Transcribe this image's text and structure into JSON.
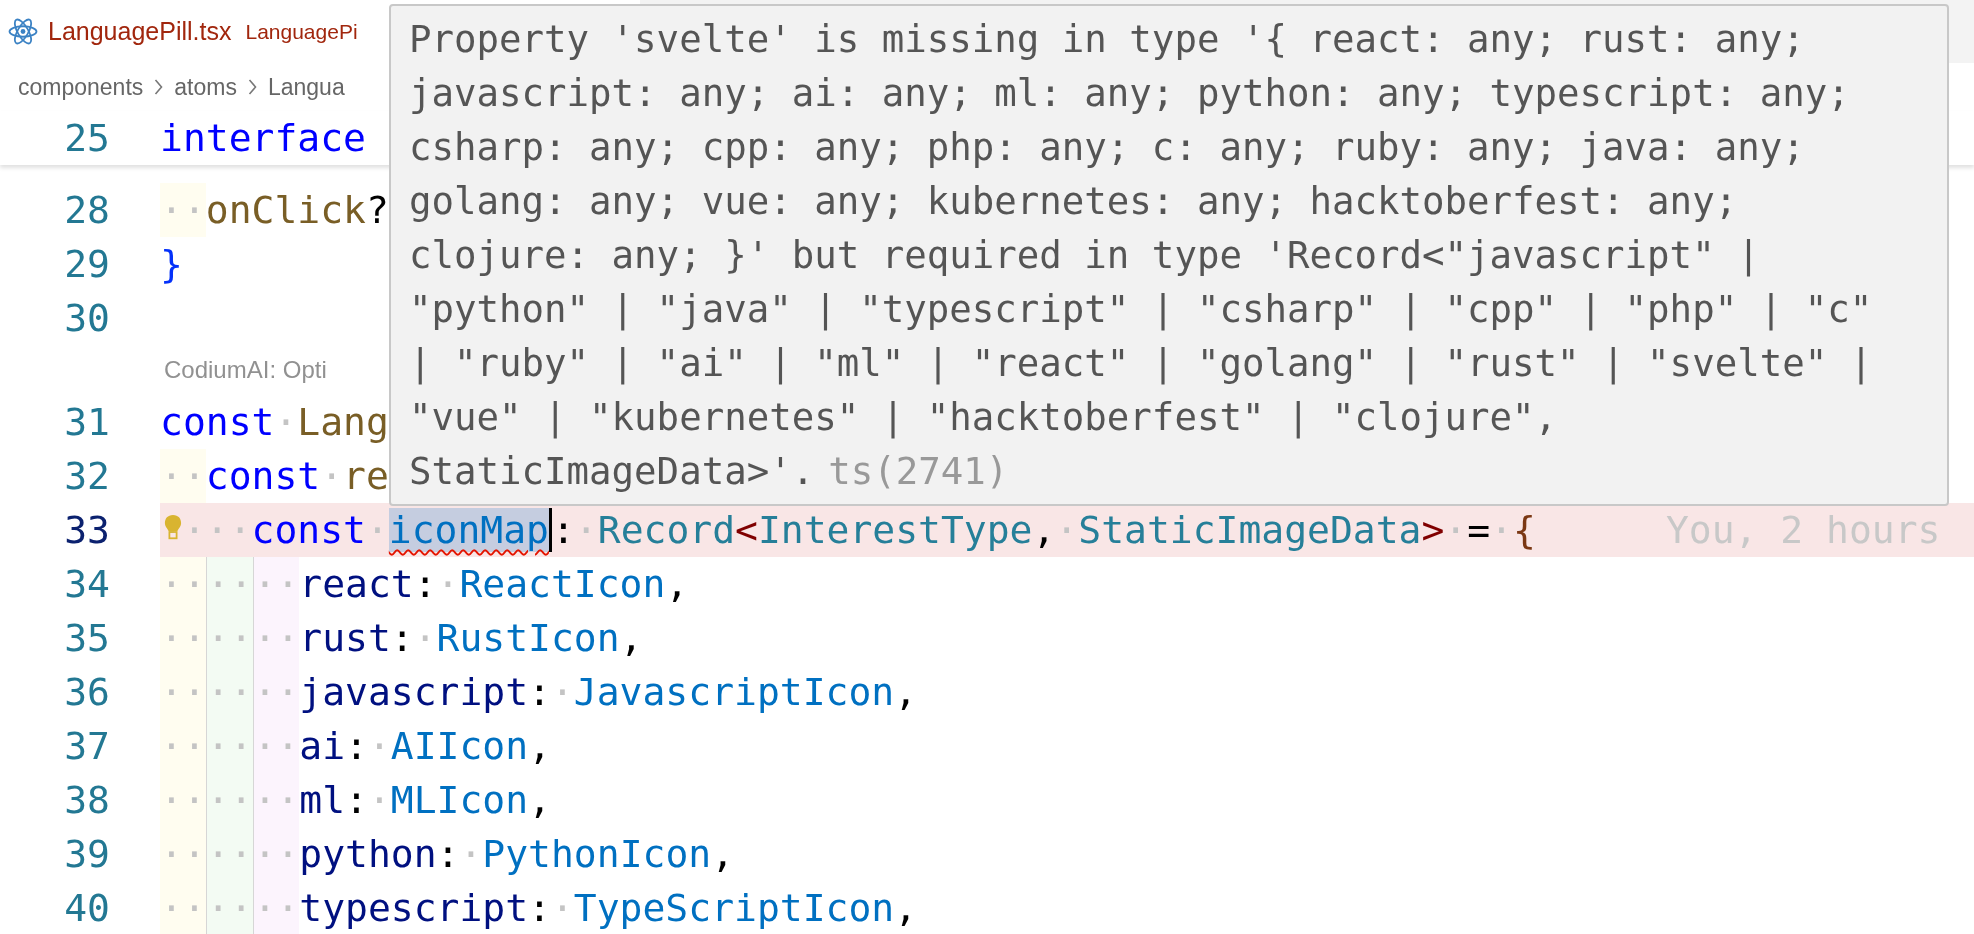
{
  "tab": {
    "title": "LanguagePill.tsx",
    "description": "LanguagePi",
    "has_error": true
  },
  "breadcrumbs": [
    "components",
    "atoms",
    "Langua"
  ],
  "sticky_line": {
    "number": "25",
    "tokens": [
      {
        "kind": "keyword",
        "text": "interface"
      }
    ]
  },
  "lines": [
    {
      "kind": "code",
      "number": "28",
      "current": false,
      "indent": [
        "··"
      ],
      "tokens": [
        {
          "kind": "function",
          "text": "onClick"
        },
        {
          "kind": "plain",
          "text": "?"
        }
      ]
    },
    {
      "kind": "code",
      "number": "29",
      "current": false,
      "tokens": [
        {
          "kind": "bracket1",
          "text": "}"
        }
      ]
    },
    {
      "kind": "code",
      "number": "30",
      "current": false
    },
    {
      "kind": "codelens",
      "text": "CodiumAI: Opti"
    },
    {
      "kind": "code",
      "number": "31",
      "current": false,
      "tokens": [
        {
          "kind": "keyword",
          "text": "const"
        },
        {
          "kind": "ws",
          "text": "·"
        },
        {
          "kind": "function",
          "text": "Lang"
        }
      ]
    },
    {
      "kind": "code",
      "number": "32",
      "current": false,
      "indent": [
        "··"
      ],
      "tokens": [
        {
          "kind": "keyword",
          "text": "const"
        },
        {
          "kind": "ws",
          "text": "·"
        },
        {
          "kind": "function",
          "text": "re"
        }
      ]
    },
    {
      "kind": "code",
      "number": "33",
      "current": true,
      "lightbulb": true,
      "indent": [
        "··",
        "··"
      ],
      "tokens": [
        {
          "kind": "keyword",
          "text": "const"
        },
        {
          "kind": "ws",
          "text": "·"
        },
        {
          "kind": "constant",
          "text": "iconMap",
          "selected": true,
          "error": true,
          "cursor": true
        },
        {
          "kind": "plain",
          "text": ":"
        },
        {
          "kind": "ws",
          "text": "·"
        },
        {
          "kind": "type",
          "text": "Record"
        },
        {
          "kind": "angle",
          "text": "<"
        },
        {
          "kind": "type",
          "text": "InterestType"
        },
        {
          "kind": "plain",
          "text": ","
        },
        {
          "kind": "ws",
          "text": "·"
        },
        {
          "kind": "type",
          "text": "StaticImageData"
        },
        {
          "kind": "angle",
          "text": ">"
        },
        {
          "kind": "ws",
          "text": "·"
        },
        {
          "kind": "plain",
          "text": "="
        },
        {
          "kind": "ws",
          "text": "·"
        },
        {
          "kind": "bracket3",
          "text": "{"
        }
      ],
      "blame": "You, 2 hours"
    },
    {
      "kind": "code",
      "number": "34",
      "current": false,
      "indent": [
        "··",
        "··",
        "··"
      ],
      "tokens": [
        {
          "kind": "property",
          "text": "react"
        },
        {
          "kind": "plain",
          "text": ":"
        },
        {
          "kind": "ws",
          "text": "·"
        },
        {
          "kind": "constant",
          "text": "ReactIcon"
        },
        {
          "kind": "plain",
          "text": ","
        }
      ]
    },
    {
      "kind": "code",
      "number": "35",
      "current": false,
      "indent": [
        "··",
        "··",
        "··"
      ],
      "tokens": [
        {
          "kind": "property",
          "text": "rust"
        },
        {
          "kind": "plain",
          "text": ":"
        },
        {
          "kind": "ws",
          "text": "·"
        },
        {
          "kind": "constant",
          "text": "RustIcon"
        },
        {
          "kind": "plain",
          "text": ","
        }
      ]
    },
    {
      "kind": "code",
      "number": "36",
      "current": false,
      "indent": [
        "··",
        "··",
        "··"
      ],
      "tokens": [
        {
          "kind": "property",
          "text": "javascript"
        },
        {
          "kind": "plain",
          "text": ":"
        },
        {
          "kind": "ws",
          "text": "·"
        },
        {
          "kind": "constant",
          "text": "JavascriptIcon"
        },
        {
          "kind": "plain",
          "text": ","
        }
      ]
    },
    {
      "kind": "code",
      "number": "37",
      "current": false,
      "indent": [
        "··",
        "··",
        "··"
      ],
      "tokens": [
        {
          "kind": "property",
          "text": "ai"
        },
        {
          "kind": "plain",
          "text": ":"
        },
        {
          "kind": "ws",
          "text": "·"
        },
        {
          "kind": "constant",
          "text": "AIIcon"
        },
        {
          "kind": "plain",
          "text": ","
        }
      ]
    },
    {
      "kind": "code",
      "number": "38",
      "current": false,
      "indent": [
        "··",
        "··",
        "··"
      ],
      "tokens": [
        {
          "kind": "property",
          "text": "ml"
        },
        {
          "kind": "plain",
          "text": ":"
        },
        {
          "kind": "ws",
          "text": "·"
        },
        {
          "kind": "constant",
          "text": "MLIcon"
        },
        {
          "kind": "plain",
          "text": ","
        }
      ]
    },
    {
      "kind": "code",
      "number": "39",
      "current": false,
      "indent": [
        "··",
        "··",
        "··"
      ],
      "tokens": [
        {
          "kind": "property",
          "text": "python"
        },
        {
          "kind": "plain",
          "text": ":"
        },
        {
          "kind": "ws",
          "text": "·"
        },
        {
          "kind": "constant",
          "text": "PythonIcon"
        },
        {
          "kind": "plain",
          "text": ","
        }
      ]
    },
    {
      "kind": "code",
      "number": "40",
      "current": false,
      "indent": [
        "··",
        "··",
        "··"
      ],
      "tokens": [
        {
          "kind": "property",
          "text": "typescript"
        },
        {
          "kind": "plain",
          "text": ":"
        },
        {
          "kind": "ws",
          "text": "·"
        },
        {
          "kind": "constant",
          "text": "TypeScriptIcon"
        },
        {
          "kind": "plain",
          "text": ","
        }
      ]
    }
  ],
  "hover": {
    "message": "Property 'svelte' is missing in type '{ react: any; rust: any;\njavascript: any; ai: any; ml: any; python: any; typescript: any;\ncsharp: any; cpp: any; php: any; c: any; ruby: any; java: any;\ngolang: any; vue: any; kubernetes: any; hacktoberfest: any;\nclojure: any; }' but required in type 'Record<\"javascript\" |\n\"python\" | \"java\" | \"typescript\" | \"csharp\" | \"cpp\" | \"php\" | \"c\"\n| \"ruby\" | \"ai\" | \"ml\" | \"react\" | \"golang\" | \"rust\" | \"svelte\" |\n\"vue\" | \"kubernetes\" | \"hacktoberfest\" | \"clojure\",\nStaticImageData>'.",
    "code": "ts(2741)"
  }
}
